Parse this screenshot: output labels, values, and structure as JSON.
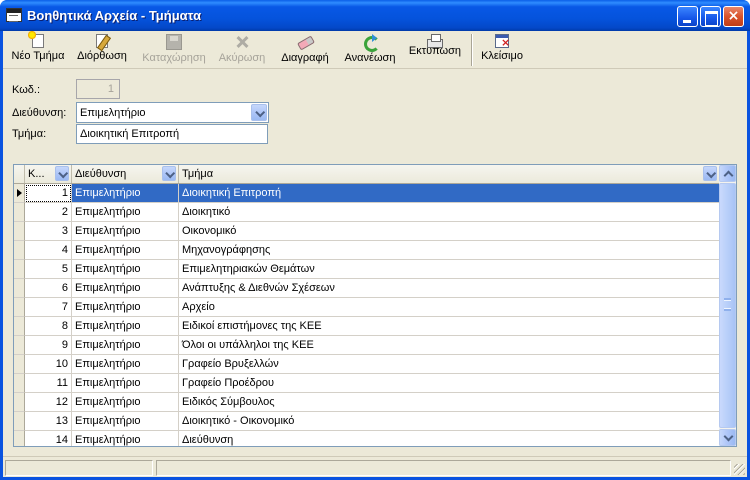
{
  "window": {
    "title": "Βοηθητικά Αρχεία - Τμήματα",
    "controls": {
      "close": "×"
    }
  },
  "toolbar": {
    "new": "Νέο Τμήμα",
    "edit": "Διόρθωση",
    "save": "Καταχώρηση",
    "cancel": "Ακύρωση",
    "delete": "Διαγραφή",
    "refresh": "Ανανέωση",
    "print": "Εκτύπωση",
    "close": "Κλείσιμο",
    "disabled": [
      "Καταχώρηση",
      "Ακύρωση"
    ]
  },
  "form": {
    "code_label": "Κωδ.:",
    "code_value": "1",
    "address_label": "Διεύθυνση:",
    "address_value": "Επιμελητήριο",
    "department_label": "Τμήμα:",
    "department_value": "Διοικητική Επιτροπή"
  },
  "grid": {
    "columns": {
      "code": "Κ...",
      "address": "Διεύθυνση",
      "department": "Τμήμα"
    },
    "selected_index": 0,
    "rows": [
      {
        "code": "1",
        "address": "Επιμελητήριο",
        "department": "Διοικητική Επιτροπή"
      },
      {
        "code": "2",
        "address": "Επιμελητήριο",
        "department": "Διοικητικό"
      },
      {
        "code": "3",
        "address": "Επιμελητήριο",
        "department": "Οικονομικό"
      },
      {
        "code": "4",
        "address": "Επιμελητήριο",
        "department": "Μηχανογράφησης"
      },
      {
        "code": "5",
        "address": "Επιμελητήριο",
        "department": "Επιμελητηριακών Θεμάτων"
      },
      {
        "code": "6",
        "address": "Επιμελητήριο",
        "department": "Ανάπτυξης & Διεθνών Σχέσεων"
      },
      {
        "code": "7",
        "address": "Επιμελητήριο",
        "department": "Αρχείο"
      },
      {
        "code": "8",
        "address": "Επιμελητήριο",
        "department": "Ειδικοί επιστήμονες της ΚΕΕ"
      },
      {
        "code": "9",
        "address": "Επιμελητήριο",
        "department": "Όλοι οι υπάλληλοι της ΚΕΕ"
      },
      {
        "code": "10",
        "address": "Επιμελητήριο",
        "department": "Γραφείο Βρυξελλών"
      },
      {
        "code": "11",
        "address": "Επιμελητήριο",
        "department": "Γραφείο Προέδρου"
      },
      {
        "code": "12",
        "address": "Επιμελητήριο",
        "department": "Ειδικός Σύμβουλος"
      },
      {
        "code": "13",
        "address": "Επιμελητήριο",
        "department": "Διοικητικό - Οικονομικό"
      },
      {
        "code": "14",
        "address": "Επιμελητήριο",
        "department": "Διεύθυνση"
      }
    ]
  },
  "colors": {
    "titlebar": "#0553dc",
    "window_bg": "#ece9d8",
    "selection": "#316ac5",
    "close_button": "#d9532c"
  },
  "icons": {
    "new": "new-document-icon",
    "edit": "edit-pencil-icon",
    "save": "floppy-disk-icon",
    "cancel": "cancel-x-icon",
    "delete": "eraser-icon",
    "refresh": "refresh-arrows-icon",
    "print": "printer-icon",
    "close": "close-window-icon"
  }
}
